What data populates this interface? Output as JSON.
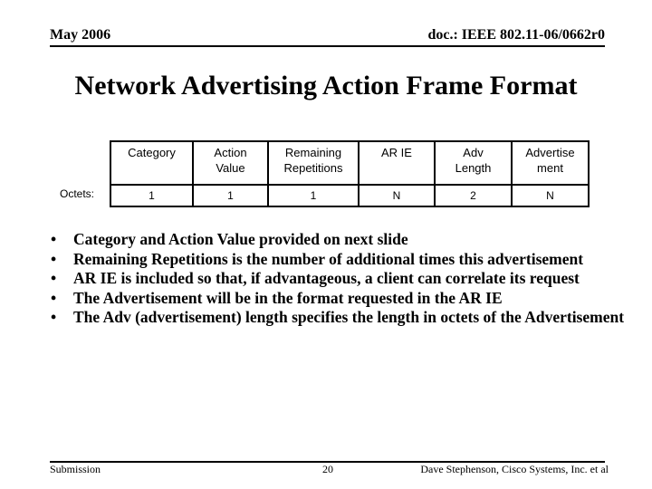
{
  "header": {
    "date": "May 2006",
    "doc_id": "doc.: IEEE 802.11-06/0662r0"
  },
  "title": "Network Advertising Action Frame Format",
  "frame_table": {
    "row_label": "Octets:",
    "columns": [
      {
        "field": "Category",
        "octets": "1"
      },
      {
        "field": "Action\nValue",
        "octets": "1"
      },
      {
        "field": "Remaining\nRepetitions",
        "octets": "1"
      },
      {
        "field": "AR IE",
        "octets": "N"
      },
      {
        "field": "Adv\nLength",
        "octets": "2"
      },
      {
        "field": "Advertise\nment",
        "octets": "N"
      }
    ]
  },
  "bullets": [
    "Category and Action Value provided on next slide",
    "Remaining Repetitions is the number of additional times this advertisement",
    "AR IE is included so that, if advantageous, a client can correlate its request",
    "The Advertisement will be in the format requested in the AR IE",
    "The Adv (advertisement) length specifies the length in octets of the Advertisement"
  ],
  "bullet_glyph": "•",
  "footer": {
    "left": "Submission",
    "page": "20",
    "author": "Dave Stephenson, Cisco Systems, Inc. et al"
  }
}
